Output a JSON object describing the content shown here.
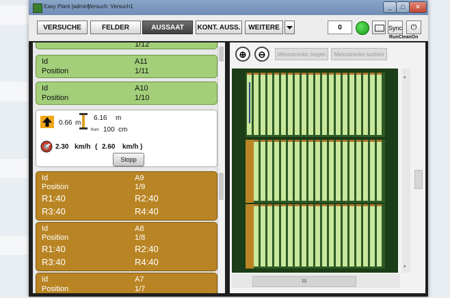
{
  "window": {
    "title": "Easy Plant [admin]",
    "version": "Versuch: Versuch1"
  },
  "toolbar": {
    "tabs": [
      "VERSUCHE",
      "FELDER",
      "AUSSAAT",
      "KONT. AUSS.",
      "WEITERE"
    ],
    "active_tab": "AUSSAAT",
    "counter": "0",
    "sync_label": "Sync",
    "runclean_label": "RunCleanOn"
  },
  "plots_top": {
    "partial": {
      "position_value": "1/12"
    },
    "a11": {
      "id_label": "Id",
      "id_value": "A11",
      "pos_label": "Position",
      "pos_value": "1/11"
    },
    "a10": {
      "id_label": "Id",
      "id_value": "A10",
      "pos_label": "Position",
      "pos_value": "1/10"
    }
  },
  "status": {
    "height_left": "0.66",
    "unit_m": "m",
    "height_right": "6.16",
    "unit_m2": "m",
    "korr_label": "Korr.",
    "korr_value": "100",
    "unit_cm": "cm",
    "speed_value": "2.30",
    "speed_unit": "km/h",
    "speed_paren_open": "(",
    "speed_set": "2.60",
    "speed_set_unit": "km/h",
    "speed_paren_close": ")",
    "stop_button": "Stopp"
  },
  "plots_bottom": {
    "a9": {
      "id_label": "Id",
      "id_value": "A9",
      "pos_label": "Position",
      "pos_value": "1/9",
      "r1": "R1:40",
      "r2": "R2:40",
      "r3": "R3:40",
      "r4": "R4:40"
    },
    "a8": {
      "id_label": "Id",
      "id_value": "A8",
      "pos_label": "Position",
      "pos_value": "1/8",
      "r1": "R1:40",
      "r2": "R2:40",
      "r3": "R3:40",
      "r4": "R4:40"
    },
    "a7": {
      "id_label": "Id",
      "id_value": "A7",
      "pos_label": "Position",
      "pos_value": "1/7"
    }
  },
  "map": {
    "btn_center": "Messstrecke zeigen",
    "btn_search": "Messstrecke suchen",
    "hscroll_grip": "III",
    "icons": [
      "zoom-in-icon",
      "zoom-out-icon"
    ]
  },
  "colors": {
    "plot_green": "#a3cf7a",
    "plot_brown": "#b98524",
    "active_tab": "#4a4a4a",
    "field_dark": "#1b3d17",
    "field_light": "#c9e79d"
  }
}
